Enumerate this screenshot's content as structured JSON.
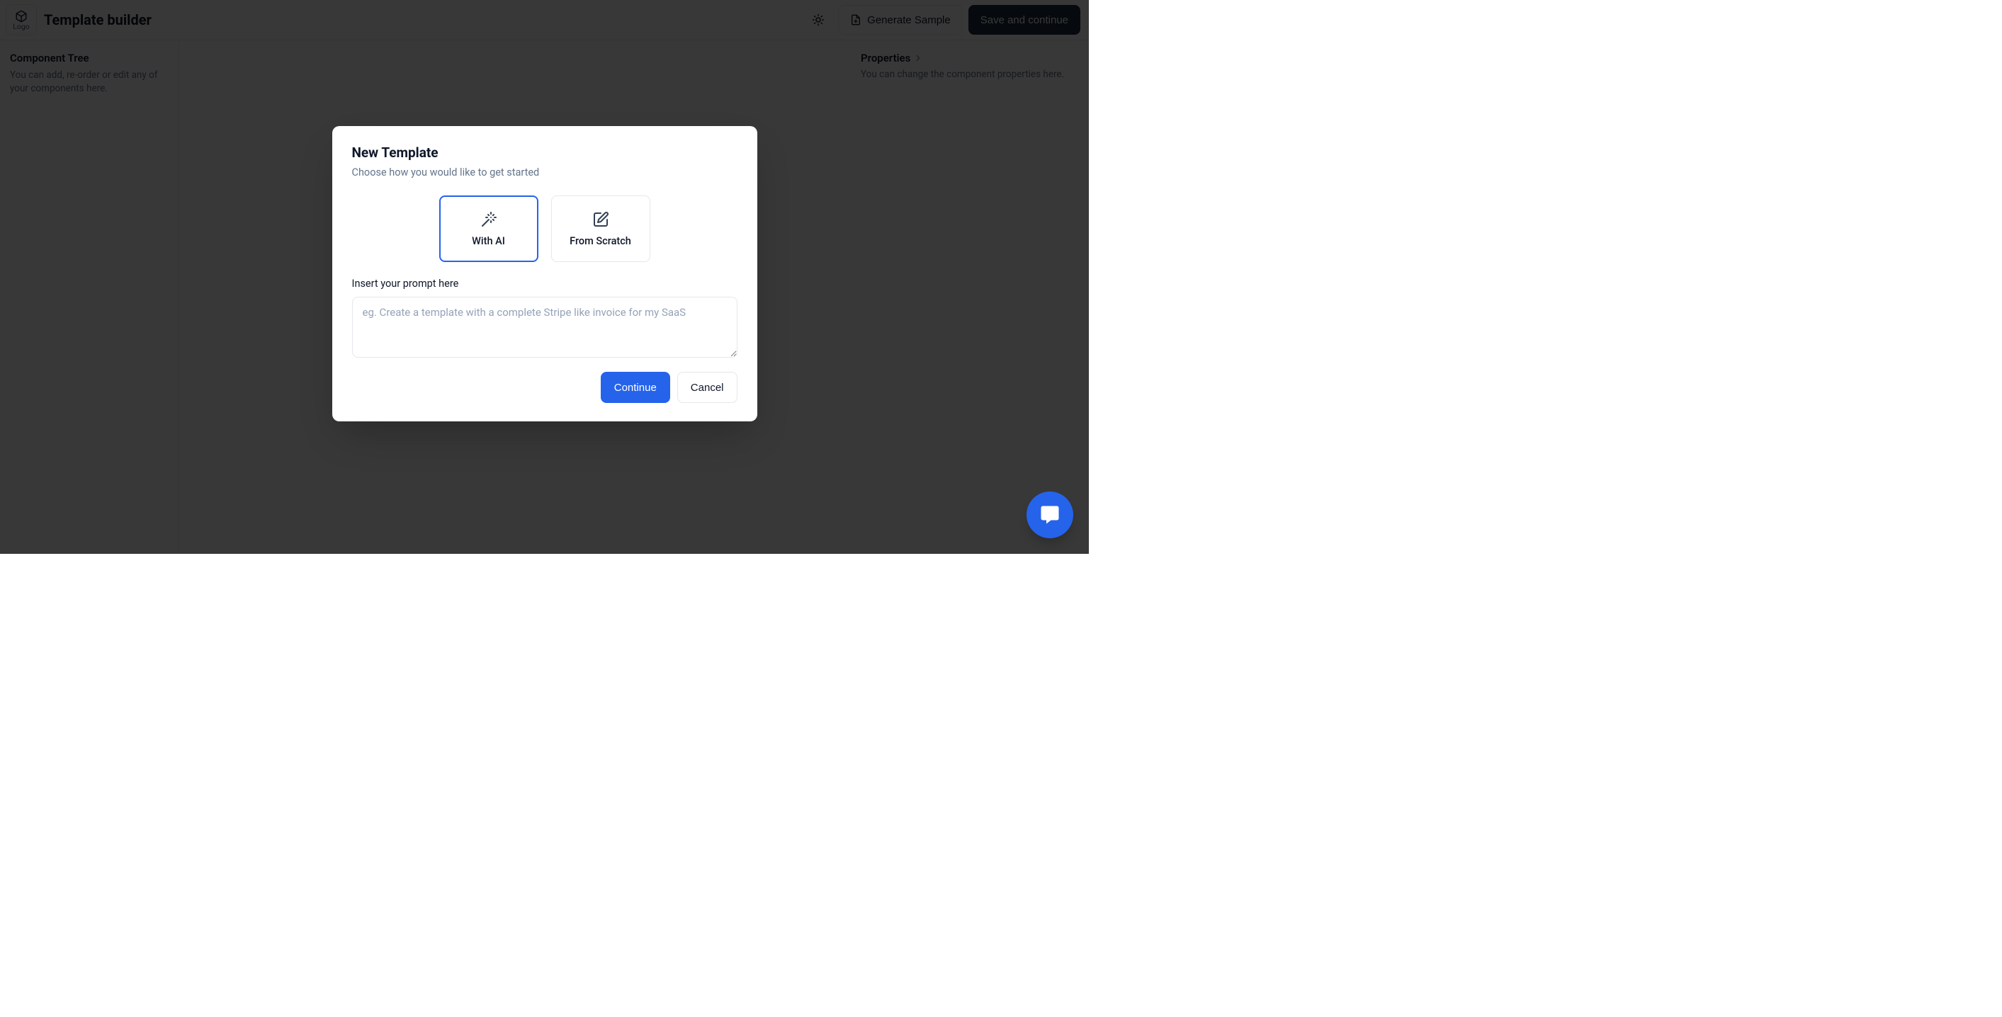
{
  "header": {
    "logo_label": "Logo",
    "title": "Template builder",
    "generate_sample_label": "Generate Sample",
    "save_continue_label": "Save and continue"
  },
  "sidebar": {
    "title": "Component Tree",
    "subtitle": "You can add, re-order or edit any of your components here."
  },
  "properties": {
    "title": "Properties",
    "subtitle": "You can change the component properties here."
  },
  "dialog": {
    "title": "New Template",
    "subtitle": "Choose how you would like to get started",
    "options": {
      "with_ai": "With AI",
      "from_scratch": "From Scratch"
    },
    "prompt_label": "Insert your prompt here",
    "prompt_placeholder": "eg. Create a template with a complete Stripe like invoice for my SaaS",
    "continue_label": "Continue",
    "cancel_label": "Cancel"
  }
}
